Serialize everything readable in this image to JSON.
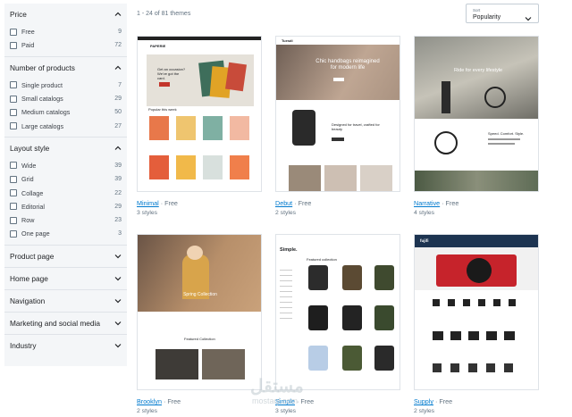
{
  "filters": [
    {
      "title": "Price",
      "expanded": true,
      "options": [
        {
          "label": "Free",
          "count": "9"
        },
        {
          "label": "Paid",
          "count": "72"
        }
      ]
    },
    {
      "title": "Number of products",
      "expanded": true,
      "options": [
        {
          "label": "Single product",
          "count": "7"
        },
        {
          "label": "Small catalogs",
          "count": "29"
        },
        {
          "label": "Medium catalogs",
          "count": "50"
        },
        {
          "label": "Large catalogs",
          "count": "27"
        }
      ]
    },
    {
      "title": "Layout style",
      "expanded": true,
      "options": [
        {
          "label": "Wide",
          "count": "39"
        },
        {
          "label": "Grid",
          "count": "39"
        },
        {
          "label": "Collage",
          "count": "22"
        },
        {
          "label": "Editorial",
          "count": "29"
        },
        {
          "label": "Row",
          "count": "23"
        },
        {
          "label": "One page",
          "count": "3"
        }
      ]
    },
    {
      "title": "Product page",
      "expanded": false
    },
    {
      "title": "Home page",
      "expanded": false
    },
    {
      "title": "Navigation",
      "expanded": false
    },
    {
      "title": "Marketing and social media",
      "expanded": false
    },
    {
      "title": "Industry",
      "expanded": false
    }
  ],
  "results_text": "1 - 24 of 81 themes",
  "sort": {
    "label": "Sort",
    "value": "Popularity"
  },
  "themes": [
    {
      "name": "Minimal",
      "price": "· Free",
      "styles": "3 styles",
      "thumb": {
        "logo": "PAPERIE",
        "hero": "Get an occasion? We've got the card.",
        "sub": "Popular this week"
      }
    },
    {
      "name": "Debut",
      "price": "· Free",
      "styles": "2 styles",
      "thumb": {
        "logo": "Tuesdi",
        "hero": "Chic handbags reimagined for modern life",
        "sub": "Designed for travel, crafted for beauty"
      }
    },
    {
      "name": "Narrative",
      "price": "· Free",
      "styles": "4 styles",
      "thumb": {
        "hero": "Ride for every lifestyle",
        "sub": "Speed. Comfort. Style."
      }
    },
    {
      "name": "Brooklyn",
      "price": "· Free",
      "styles": "2 styles",
      "thumb": {
        "hero": "Spring Collection",
        "sub": "Featured Collection"
      }
    },
    {
      "name": "Simple",
      "price": "· Free",
      "styles": "3 styles",
      "thumb": {
        "logo": "Simple.",
        "sub": "Featured collection"
      }
    },
    {
      "name": "Supply",
      "price": "· Free",
      "styles": "2 styles",
      "thumb": {
        "logo": "fujifi"
      }
    }
  ],
  "watermark": {
    "line1": "مستقل",
    "line2": "mostaql.com"
  },
  "colors": {
    "link": "#007ace",
    "sidebar": "#f4f6f8",
    "muted": "#637381"
  }
}
